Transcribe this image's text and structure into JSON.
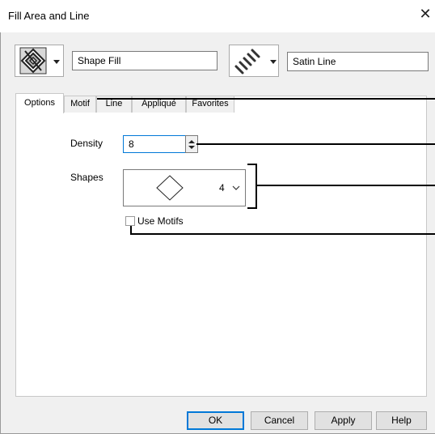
{
  "window": {
    "title": "Fill Area and Line",
    "close_glyph": "✕"
  },
  "fill": {
    "icon": "fill-pattern-icon",
    "value": "Shape Fill"
  },
  "line": {
    "icon": "satin-line-icon",
    "value": "Satin Line"
  },
  "tabs": [
    {
      "label": "Options"
    },
    {
      "label": "Motif"
    },
    {
      "label": "Line"
    },
    {
      "label": "Appliqué"
    },
    {
      "label": "Favorites"
    }
  ],
  "options": {
    "density_label": "Density",
    "density_value": "8",
    "shapes_label": "Shapes",
    "shapes_value": "4",
    "use_motifs_label": "Use Motifs",
    "use_motifs_checked": false
  },
  "buttons": {
    "ok": "OK",
    "cancel": "Cancel",
    "apply": "Apply",
    "help": "Help"
  },
  "colors": {
    "accent": "#0078d7",
    "dialog_bg": "#f0f0f0",
    "panel_bg": "#ffffff"
  }
}
